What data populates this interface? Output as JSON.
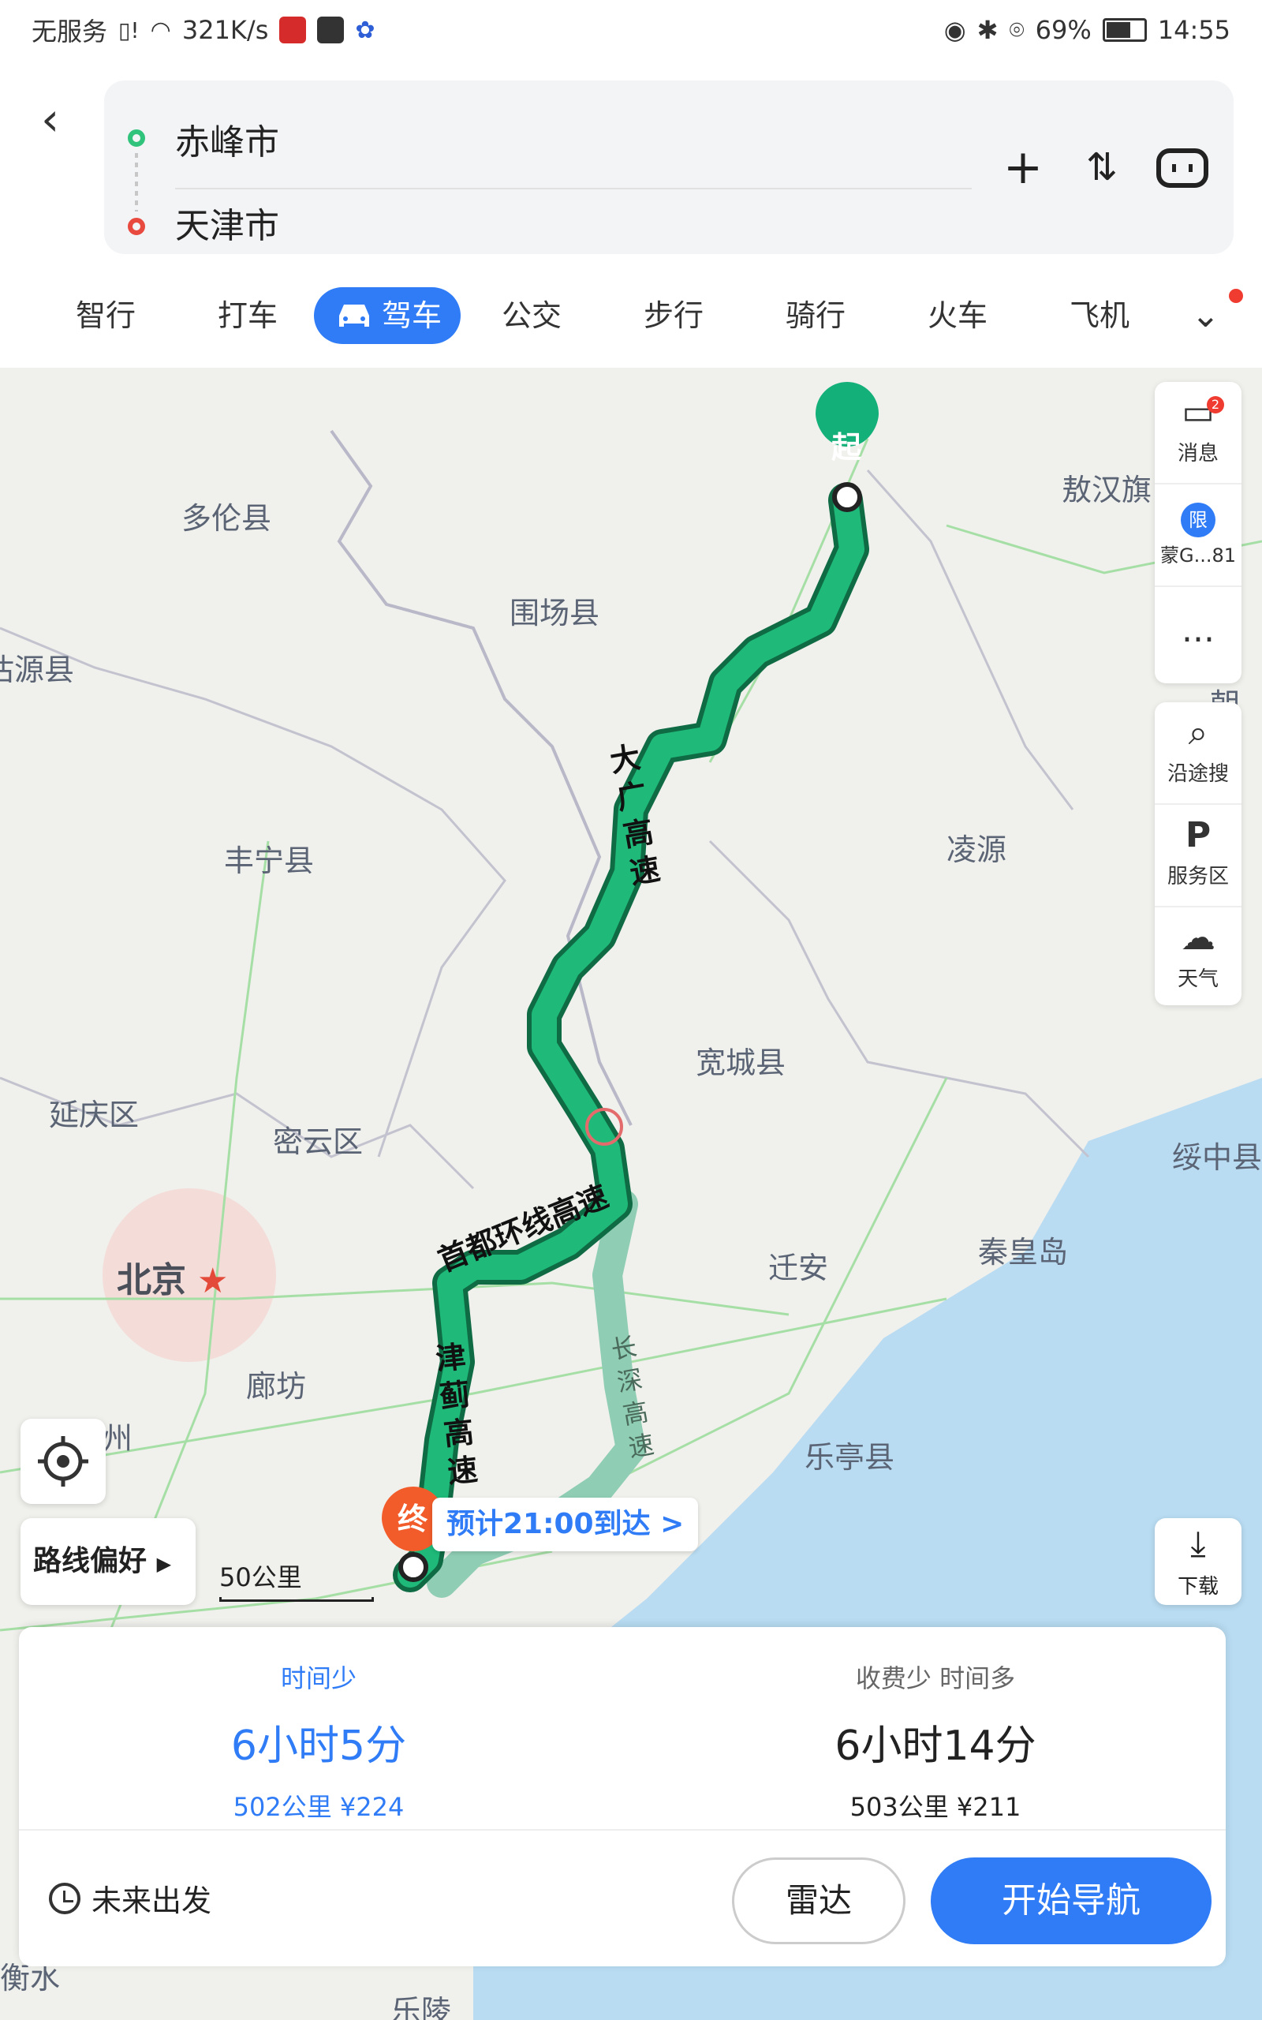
{
  "status_bar": {
    "carrier": "无服务",
    "speed": "321K/s",
    "battery": "69%",
    "time": "14:55",
    "icons": [
      "sim-alert-icon",
      "wifi-icon",
      "mic-app-icon",
      "map-app-icon",
      "baidu-paw-icon",
      "eye-icon",
      "bluetooth-icon",
      "location-icon",
      "battery-icon"
    ]
  },
  "search": {
    "from": "赤峰市",
    "to": "天津市"
  },
  "header_actions": [
    "add-icon",
    "swap-icon",
    "car-connect-icon"
  ],
  "modes": [
    {
      "label": "智行"
    },
    {
      "label": "打车"
    },
    {
      "label": "驾车",
      "active": true
    },
    {
      "label": "公交"
    },
    {
      "label": "步行"
    },
    {
      "label": "骑行"
    },
    {
      "label": "火车"
    },
    {
      "label": "飞机"
    }
  ],
  "map": {
    "labels": {
      "duolun": "多伦县",
      "aohan": "敖汉旗",
      "weichang": "围场县",
      "guyuan": "沽源县",
      "chaoyang": "朝阳",
      "fengning": "丰宁县",
      "lingyuan": "凌源",
      "kuancheng": "宽城县",
      "yanqing": "延庆区",
      "miyun": "密云区",
      "suizhong": "绥中县",
      "beijing": "北京",
      "qianan": "迁安",
      "qinhuangdao": "秦皇岛",
      "langfang": "廊坊",
      "zhou": "州",
      "laoting": "乐亭县",
      "hengshui": "衡水",
      "leling": "乐陵"
    },
    "roads": {
      "daguang": "大广高速",
      "shoudu": "首都环线高速",
      "jinji": "津蓟高速",
      "changshen": "长深高速"
    },
    "start_marker": "起",
    "end_marker": "终",
    "eta": "预计21:00到达 >",
    "scale": "50公里",
    "colors": {
      "route": "#1aa36b",
      "route_alt": "#8fcdb5",
      "accent": "#2f7cf6",
      "sea": "#b9dcf2"
    }
  },
  "right_panel": {
    "messages": {
      "label": "消息",
      "badge": "2"
    },
    "restriction": {
      "badge": "限",
      "label": "蒙G...81"
    },
    "more": "...",
    "along": "沿途搜",
    "service": "服务区",
    "weather": "天气",
    "download": "下载"
  },
  "left_controls": {
    "pref": "路线偏好"
  },
  "routes": [
    {
      "tag": "时间少",
      "time": "6小时5分",
      "meta": "502公里  ¥224",
      "selected": true
    },
    {
      "tag": "收费少  时间多",
      "time": "6小时14分",
      "meta": "503公里  ¥211",
      "selected": false
    }
  ],
  "bottom": {
    "future": "未来出发",
    "radar": "雷达",
    "start_nav": "开始导航"
  }
}
